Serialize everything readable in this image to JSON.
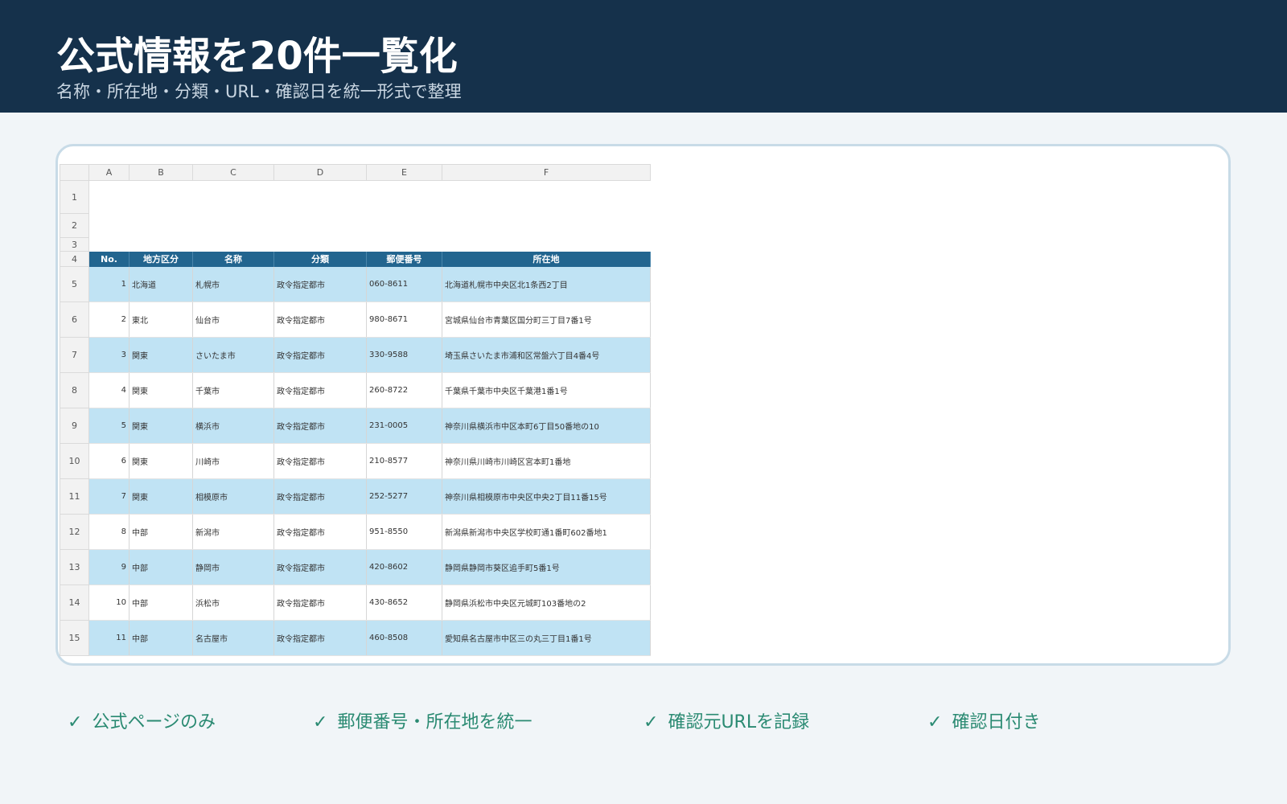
{
  "header": {
    "title": "公式情報を20件一覧化",
    "subtitle": "名称・所在地・分類・URL・確認日を統一形式で整理"
  },
  "spreadsheet": {
    "columns": [
      "A",
      "B",
      "C",
      "D",
      "E",
      "F"
    ],
    "blank_rows": [
      "1",
      "2",
      "3"
    ],
    "header_row_number": "4",
    "table_headers": [
      "No.",
      "地方区分",
      "名称",
      "分類",
      "郵便番号",
      "所在地"
    ],
    "rows": [
      {
        "rownum": "5",
        "no": "1",
        "region": "北海道",
        "name": "札幌市",
        "category": "政令指定都市",
        "postal": "060-8611",
        "address": "北海道札幌市中央区北1条西2丁目"
      },
      {
        "rownum": "6",
        "no": "2",
        "region": "東北",
        "name": "仙台市",
        "category": "政令指定都市",
        "postal": "980-8671",
        "address": "宮城県仙台市青葉区国分町三丁目7番1号"
      },
      {
        "rownum": "7",
        "no": "3",
        "region": "関東",
        "name": "さいたま市",
        "category": "政令指定都市",
        "postal": "330-9588",
        "address": "埼玉県さいたま市浦和区常盤六丁目4番4号"
      },
      {
        "rownum": "8",
        "no": "4",
        "region": "関東",
        "name": "千葉市",
        "category": "政令指定都市",
        "postal": "260-8722",
        "address": "千葉県千葉市中央区千葉港1番1号"
      },
      {
        "rownum": "9",
        "no": "5",
        "region": "関東",
        "name": "横浜市",
        "category": "政令指定都市",
        "postal": "231-0005",
        "address": "神奈川県横浜市中区本町6丁目50番地の10"
      },
      {
        "rownum": "10",
        "no": "6",
        "region": "関東",
        "name": "川崎市",
        "category": "政令指定都市",
        "postal": "210-8577",
        "address": "神奈川県川崎市川崎区宮本町1番地"
      },
      {
        "rownum": "11",
        "no": "7",
        "region": "関東",
        "name": "相模原市",
        "category": "政令指定都市",
        "postal": "252-5277",
        "address": "神奈川県相模原市中央区中央2丁目11番15号"
      },
      {
        "rownum": "12",
        "no": "8",
        "region": "中部",
        "name": "新潟市",
        "category": "政令指定都市",
        "postal": "951-8550",
        "address": "新潟県新潟市中央区学校町通1番町602番地1"
      },
      {
        "rownum": "13",
        "no": "9",
        "region": "中部",
        "name": "静岡市",
        "category": "政令指定都市",
        "postal": "420-8602",
        "address": "静岡県静岡市葵区追手町5番1号"
      },
      {
        "rownum": "14",
        "no": "10",
        "region": "中部",
        "name": "浜松市",
        "category": "政令指定都市",
        "postal": "430-8652",
        "address": "静岡県浜松市中央区元城町103番地の2"
      },
      {
        "rownum": "15",
        "no": "11",
        "region": "中部",
        "name": "名古屋市",
        "category": "政令指定都市",
        "postal": "460-8508",
        "address": "愛知県名古屋市中区三の丸三丁目1番1号"
      }
    ]
  },
  "checks": [
    {
      "mark": "✓",
      "label": "公式ページのみ"
    },
    {
      "mark": "✓",
      "label": "郵便番号・所在地を統一"
    },
    {
      "mark": "✓",
      "label": "確認元URLを記録"
    },
    {
      "mark": "✓",
      "label": "確認日付き"
    }
  ],
  "colors": {
    "header_bg": "#15314b",
    "table_header_bg": "#22658f",
    "row_highlight": "#c0e3f4",
    "check_color": "#2a8a72"
  }
}
